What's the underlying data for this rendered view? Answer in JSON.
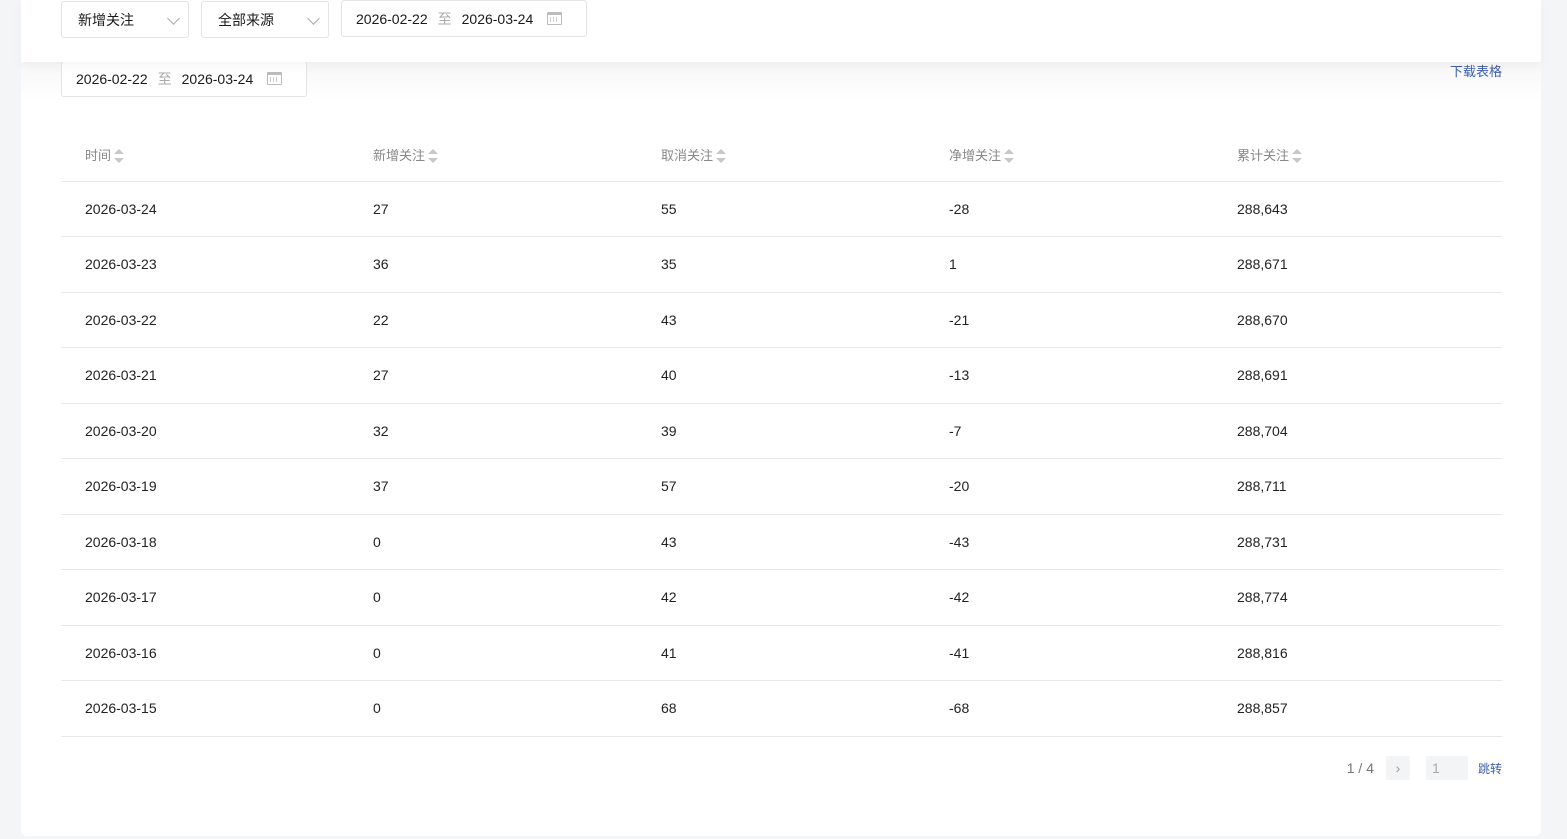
{
  "filters": {
    "metric": "新增关注",
    "source": "全部来源",
    "date_start": "2026-02-22",
    "date_sep": "至",
    "date_end": "2026-03-24"
  },
  "table_filter": {
    "date_start": "2026-02-22",
    "date_sep": "至",
    "date_end": "2026-03-24"
  },
  "download_label": "下载表格",
  "columns": [
    "时间",
    "新增关注",
    "取消关注",
    "净增关注",
    "累计关注"
  ],
  "rows": [
    [
      "2026-03-24",
      "27",
      "55",
      "-28",
      "288,643"
    ],
    [
      "2026-03-23",
      "36",
      "35",
      "1",
      "288,671"
    ],
    [
      "2026-03-22",
      "22",
      "43",
      "-21",
      "288,670"
    ],
    [
      "2026-03-21",
      "27",
      "40",
      "-13",
      "288,691"
    ],
    [
      "2026-03-20",
      "32",
      "39",
      "-7",
      "288,704"
    ],
    [
      "2026-03-19",
      "37",
      "57",
      "-20",
      "288,711"
    ],
    [
      "2026-03-18",
      "0",
      "43",
      "-43",
      "288,731"
    ],
    [
      "2026-03-17",
      "0",
      "42",
      "-42",
      "288,774"
    ],
    [
      "2026-03-16",
      "0",
      "41",
      "-41",
      "288,816"
    ],
    [
      "2026-03-15",
      "0",
      "68",
      "-68",
      "288,857"
    ]
  ],
  "pagination": {
    "current": "1",
    "sep": " / ",
    "total": "4",
    "next": "›",
    "input_value": "1",
    "jump_label": "跳转"
  }
}
